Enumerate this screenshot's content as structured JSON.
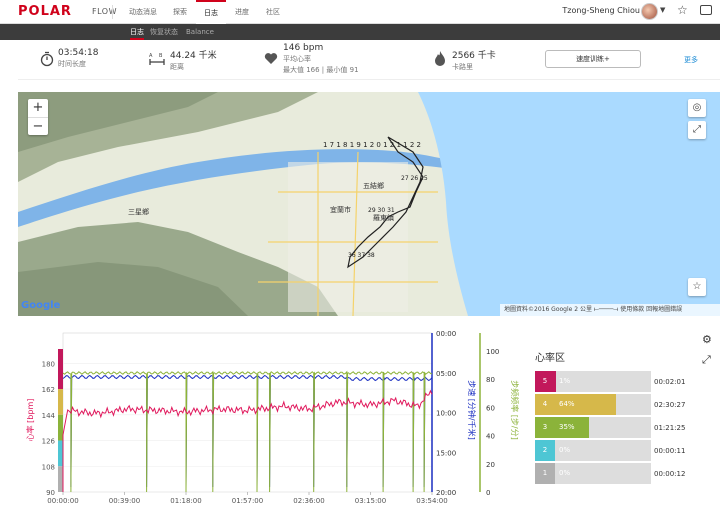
{
  "brand": {
    "logo": "POLAR",
    "product": "FLOW"
  },
  "nav": {
    "items": [
      "动态消息",
      "探索",
      "日志",
      "进度",
      "社区"
    ],
    "active": "日志"
  },
  "user": {
    "name": "Tzong-Sheng Chiou"
  },
  "subnav": {
    "items": [
      "日志",
      "恢复状态",
      "Balance"
    ],
    "active": "日志"
  },
  "summary": {
    "duration": {
      "value": "03:54:18",
      "label": "时间长度"
    },
    "distance": {
      "value": "44.24 千米",
      "label": "距离"
    },
    "heart_rate": {
      "value": "146 bpm",
      "label": "平均心率",
      "detail": "最大值 166 | 最小值 91"
    },
    "calories": {
      "value": "2566 千卡",
      "label": "卡路里"
    },
    "speed_button": "速度训练+",
    "more_link": "更多"
  },
  "map": {
    "footer": "地圖資料©2016 Google   2 公里 ⟝────⟞   使用條款   回報地圖錯誤",
    "provider": "Google",
    "labels": [
      "宜蘭市",
      "五結鄉",
      "三星鄉",
      "羅東鎮"
    ],
    "lap_markers": [
      "1",
      "2",
      "3",
      "4",
      "5",
      "6",
      "7",
      "8",
      "9",
      "10",
      "11",
      "12",
      "13",
      "14",
      "15",
      "16",
      "17",
      "18",
      "19",
      "20",
      "21",
      "22",
      "23",
      "24",
      "25",
      "26",
      "27",
      "28",
      "29",
      "30",
      "31",
      "32",
      "33",
      "34",
      "35",
      "36",
      "37",
      "38",
      "39",
      "40",
      "41",
      "42",
      "43",
      "44"
    ],
    "colors": {
      "water": "#aadaff",
      "land": "#e8ebdc",
      "mountain": "#9aa98c",
      "river": "#7fb4e8",
      "route": "#222222"
    }
  },
  "chart_data": {
    "type": "line",
    "x_ticks": [
      "00:00:00",
      "00:39:00",
      "01:18:00",
      "01:57:00",
      "02:36:00",
      "03:15:00",
      "03:54:00"
    ],
    "left_axis": {
      "label": "心率 [bpm]",
      "ticks": [
        "180",
        "162",
        "144",
        "126",
        "108",
        "90"
      ],
      "range": [
        90,
        190
      ]
    },
    "right_axis_1": {
      "label": "步速 [分钟/千米]",
      "ticks": [
        "00:00",
        "05:00",
        "10:00",
        "15:00",
        "20:00"
      ]
    },
    "right_axis_2": {
      "label": "步频频率 [步/分]",
      "ticks": [
        "100",
        "80",
        "60",
        "40",
        "20",
        "0"
      ]
    },
    "series": [
      {
        "name": "心率",
        "color": "#e0185c"
      },
      {
        "name": "步速",
        "color": "#1a2ec0"
      },
      {
        "name": "步频",
        "color": "#8db33a"
      }
    ],
    "hr_start": 90,
    "hr_trend": [
      [
        0,
        148
      ],
      [
        10,
        146
      ],
      [
        20,
        145
      ],
      [
        30,
        146
      ],
      [
        40,
        148
      ],
      [
        60,
        147
      ],
      [
        78,
        146
      ],
      [
        100,
        148
      ],
      [
        117,
        147
      ],
      [
        140,
        150
      ],
      [
        156,
        148
      ],
      [
        175,
        153
      ],
      [
        195,
        151
      ],
      [
        210,
        154
      ],
      [
        225,
        150
      ],
      [
        234,
        161
      ]
    ],
    "cadence_drops_min": [
      5,
      53,
      78,
      95,
      123,
      131,
      159,
      180,
      203,
      222,
      229
    ],
    "colors": {
      "heart_rate": "#e0185c",
      "pace": "#1a2ec0",
      "cadence": "#8db33a"
    }
  },
  "heart_rate_zones": {
    "title": "心率区",
    "zones": [
      {
        "zone": "5",
        "percent": "1%",
        "fraction": 0.01,
        "time": "00:02:01",
        "color": "#c2185b"
      },
      {
        "zone": "4",
        "percent": "64%",
        "fraction": 0.64,
        "time": "02:30:27",
        "color": "#d6b84a"
      },
      {
        "zone": "3",
        "percent": "35%",
        "fraction": 0.35,
        "time": "01:21:25",
        "color": "#8bb33a"
      },
      {
        "zone": "2",
        "percent": "0%",
        "fraction": 0.0,
        "time": "00:00:11",
        "color": "#4ec6d4"
      },
      {
        "zone": "1",
        "percent": "0%",
        "fraction": 0.0,
        "time": "00:00:12",
        "color": "#b0b0b0"
      }
    ]
  }
}
